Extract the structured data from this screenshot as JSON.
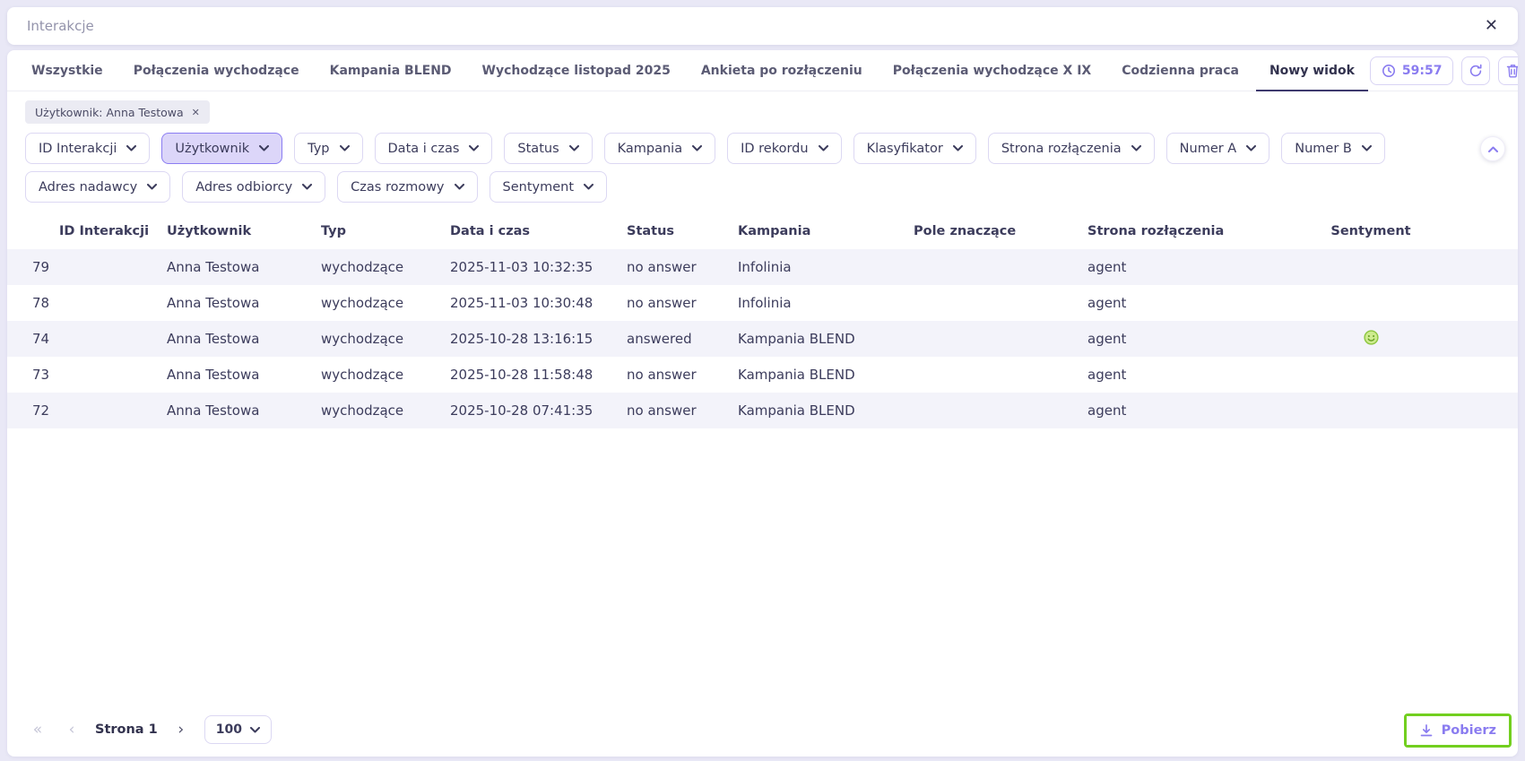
{
  "modal": {
    "title": "Interakcje"
  },
  "icons": {
    "close": "✕",
    "chip_remove": "✕",
    "first_page": "«",
    "prev_page": "‹",
    "next_page": "›"
  },
  "tabs": {
    "items": [
      {
        "label": "Wszystkie",
        "active": false
      },
      {
        "label": "Połączenia wychodzące",
        "active": false
      },
      {
        "label": "Kampania BLEND",
        "active": false
      },
      {
        "label": "Wychodzące listopad 2025",
        "active": false
      },
      {
        "label": "Ankieta po rozłączeniu",
        "active": false
      },
      {
        "label": "Połączenia wychodzące X IX",
        "active": false
      },
      {
        "label": "Codzienna praca",
        "active": false
      },
      {
        "label": "Nowy widok",
        "active": true
      }
    ]
  },
  "toolbar": {
    "timer": "59:57"
  },
  "filters": {
    "chip": "Użytkownik: Anna Testowa",
    "active": "Użytkownik",
    "row1": [
      "ID Interakcji",
      "Użytkownik",
      "Typ",
      "Data i czas",
      "Status",
      "Kampania",
      "ID rekordu",
      "Klasyfikator",
      "Strona rozłączenia",
      "Numer A",
      "Numer B"
    ],
    "row2": [
      "Adres nadawcy",
      "Adres odbiorcy",
      "Czas rozmowy",
      "Sentyment"
    ]
  },
  "table": {
    "columns": [
      "ID Interakcji",
      "Użytkownik",
      "Typ",
      "Data i czas",
      "Status",
      "Kampania",
      "Pole znaczące",
      "Strona rozłączenia",
      "Sentyment"
    ],
    "rows": [
      {
        "cells": [
          "79",
          "Anna Testowa",
          "wychodzące",
          "2025-11-03 10:32:35",
          "no answer",
          "Infolinia",
          "",
          "agent"
        ],
        "sentiment": ""
      },
      {
        "cells": [
          "78",
          "Anna Testowa",
          "wychodzące",
          "2025-11-03 10:30:48",
          "no answer",
          "Infolinia",
          "",
          "agent"
        ],
        "sentiment": ""
      },
      {
        "cells": [
          "74",
          "Anna Testowa",
          "wychodzące",
          "2025-10-28 13:16:15",
          "answered",
          "Kampania BLEND",
          "",
          "agent"
        ],
        "sentiment": "positive"
      },
      {
        "cells": [
          "73",
          "Anna Testowa",
          "wychodzące",
          "2025-10-28 11:58:48",
          "no answer",
          "Kampania BLEND",
          "",
          "agent"
        ],
        "sentiment": ""
      },
      {
        "cells": [
          "72",
          "Anna Testowa",
          "wychodzące",
          "2025-10-28 07:41:35",
          "no answer",
          "Kampania BLEND",
          "",
          "agent"
        ],
        "sentiment": ""
      }
    ]
  },
  "pagination": {
    "page_label": "Strona 1",
    "page_size": "100"
  },
  "download": {
    "label": "Pobierz"
  },
  "colors": {
    "accent": "#8a7cf0",
    "tab_underline": "#3e3a6e",
    "active_filter_bg": "#dcd6f9",
    "active_filter_border": "#8b7df2",
    "zebra_row": "#f3f3fa",
    "highlight_green": "#72cf1f",
    "sentiment_positive": "#8cc63f",
    "page_background": "#e9e8f6"
  }
}
